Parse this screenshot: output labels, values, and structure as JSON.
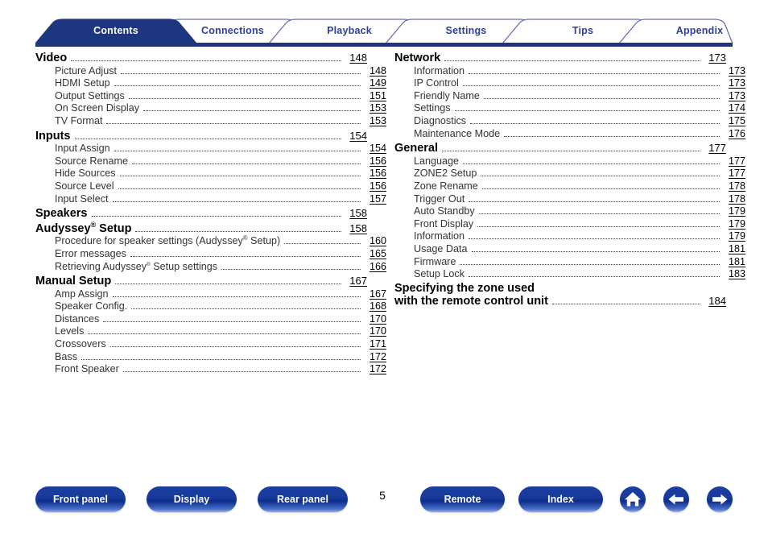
{
  "document": {
    "page_number": "5"
  },
  "tabs": [
    {
      "label": "Contents",
      "active": true,
      "name": "tab-contents"
    },
    {
      "label": "Connections",
      "active": false,
      "name": "tab-connections"
    },
    {
      "label": "Playback",
      "active": false,
      "name": "tab-playback"
    },
    {
      "label": "Settings",
      "active": false,
      "name": "tab-settings"
    },
    {
      "label": "Tips",
      "active": false,
      "name": "tab-tips"
    },
    {
      "label": "Appendix",
      "active": false,
      "name": "tab-appendix"
    }
  ],
  "colors": {
    "tab_active_fill": "#1e357f",
    "tab_inactive_text": "#2d3f96",
    "tab_border": "#5a63a8",
    "tab_underline_bar": "#1e357f",
    "button_blue": "#123a96",
    "leader_dots": "#404040"
  },
  "toc": {
    "left_column": [
      {
        "level": 1,
        "title": "Video",
        "page": "148"
      },
      {
        "level": 2,
        "title": "Picture Adjust",
        "page": "148"
      },
      {
        "level": 2,
        "title": "HDMI Setup",
        "page": "149"
      },
      {
        "level": 2,
        "title": "Output Settings",
        "page": "151"
      },
      {
        "level": 2,
        "title": "On Screen Display",
        "page": "153"
      },
      {
        "level": 2,
        "title": "TV Format",
        "page": "153"
      },
      {
        "level": 1,
        "title": "Inputs",
        "page": "154"
      },
      {
        "level": 2,
        "title": "Input Assign",
        "page": "154"
      },
      {
        "level": 2,
        "title": "Source Rename",
        "page": "156"
      },
      {
        "level": 2,
        "title": "Hide Sources",
        "page": "156"
      },
      {
        "level": 2,
        "title": "Source Level",
        "page": "156"
      },
      {
        "level": 2,
        "title": "Input Select",
        "page": "157"
      },
      {
        "level": 1,
        "title": "Speakers",
        "page": "158"
      },
      {
        "level": 1,
        "title": "Audyssey® Setup",
        "page": "158",
        "html": "Audyssey<sup class=\"reg\">®</sup> Setup"
      },
      {
        "level": 2,
        "title": "Procedure for speaker settings (Audyssey® Setup)",
        "page": "160",
        "html": "Procedure for speaker settings (Audyssey<sup class=\"reg\">®</sup> Setup)"
      },
      {
        "level": 2,
        "title": "Error messages",
        "page": "165"
      },
      {
        "level": 2,
        "title": "Retrieving Audyssey® Setup settings",
        "page": "166",
        "html": "Retrieving Audyssey<sup class=\"reg-sm\">®</sup> Setup settings"
      },
      {
        "level": 1,
        "title": "Manual Setup",
        "page": "167"
      },
      {
        "level": 2,
        "title": "Amp Assign",
        "page": "167"
      },
      {
        "level": 2,
        "title": "Speaker Config.",
        "page": "168"
      },
      {
        "level": 2,
        "title": "Distances",
        "page": "170"
      },
      {
        "level": 2,
        "title": "Levels",
        "page": "170"
      },
      {
        "level": 2,
        "title": "Crossovers",
        "page": "171"
      },
      {
        "level": 2,
        "title": "Bass",
        "page": "172"
      },
      {
        "level": 2,
        "title": "Front Speaker",
        "page": "172"
      }
    ],
    "right_column": [
      {
        "level": 1,
        "title": "Network",
        "page": "173"
      },
      {
        "level": 2,
        "title": "Information",
        "page": "173"
      },
      {
        "level": 2,
        "title": "IP Control",
        "page": "173"
      },
      {
        "level": 2,
        "title": "Friendly Name",
        "page": "173"
      },
      {
        "level": 2,
        "title": "Settings",
        "page": "174"
      },
      {
        "level": 2,
        "title": "Diagnostics",
        "page": "175"
      },
      {
        "level": 2,
        "title": "Maintenance Mode",
        "page": "176"
      },
      {
        "level": 1,
        "title": "General",
        "page": "177"
      },
      {
        "level": 2,
        "title": "Language",
        "page": "177"
      },
      {
        "level": 2,
        "title": "ZONE2 Setup",
        "page": "177"
      },
      {
        "level": 2,
        "title": "Zone Rename",
        "page": "178"
      },
      {
        "level": 2,
        "title": "Trigger Out",
        "page": "178"
      },
      {
        "level": 2,
        "title": "Auto Standby",
        "page": "179"
      },
      {
        "level": 2,
        "title": "Front Display",
        "page": "179"
      },
      {
        "level": 2,
        "title": "Information",
        "page": "179"
      },
      {
        "level": 2,
        "title": "Usage Data",
        "page": "181"
      },
      {
        "level": 2,
        "title": "Firmware",
        "page": "181"
      },
      {
        "level": 2,
        "title": "Setup Lock",
        "page": "183"
      },
      {
        "level": 1,
        "title": "Specifying the zone used with the remote control unit",
        "page": "184",
        "twoline": true,
        "line1": "Specifying the zone used",
        "line2": "with the remote control unit"
      }
    ]
  },
  "footer": {
    "buttons": [
      {
        "label": "Front panel",
        "name": "front-panel-button"
      },
      {
        "label": "Display",
        "name": "display-button"
      },
      {
        "label": "Rear panel",
        "name": "rear-panel-button"
      },
      {
        "label": "Remote",
        "name": "remote-button"
      },
      {
        "label": "Index",
        "name": "index-button"
      }
    ],
    "icons": [
      {
        "icon": "home-icon",
        "name": "home-button"
      },
      {
        "icon": "arrow-left-icon",
        "name": "back-button"
      },
      {
        "icon": "arrow-right-icon",
        "name": "forward-button"
      }
    ]
  }
}
